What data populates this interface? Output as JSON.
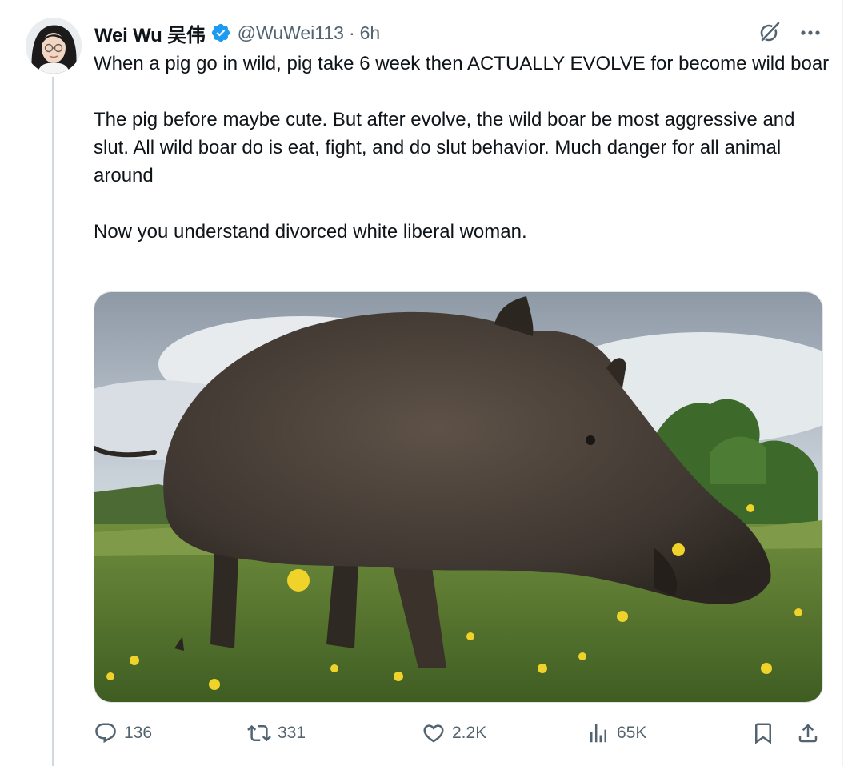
{
  "tweet": {
    "author": {
      "display_name": "Wei Wu 吴伟",
      "handle": "@WuWei113",
      "verified": true,
      "avatar_icon": "profile-photo"
    },
    "timestamp": "6h",
    "separator": "·",
    "text": {
      "paragraph_1": "When a pig go in wild, pig take 6 week then ACTUALLY EVOLVE for become wild boar",
      "paragraph_2": "The pig before maybe cute. But after evolve, the wild boar be most aggressive and slut. All wild boar do is eat, fight, and do slut behavior. Much danger for all animal around",
      "paragraph_3": "Now you understand divorced white liberal woman."
    },
    "media": {
      "type": "photo",
      "subject": "wild-boar-in-meadow-photo"
    },
    "actions": {
      "replies": "136",
      "reposts": "331",
      "likes": "2.2K",
      "views": "65K"
    },
    "icons": {
      "verified": "verified-badge-icon",
      "grok": "grok-icon",
      "more": "more-icon",
      "reply": "reply-icon",
      "repost": "repost-icon",
      "like": "heart-icon",
      "views": "views-icon",
      "bookmark": "bookmark-icon",
      "share": "share-icon"
    },
    "colors": {
      "text_primary": "#0f1419",
      "text_secondary": "#536471",
      "verified_blue": "#1d9bf0",
      "thread_line": "#cfd9de"
    }
  }
}
